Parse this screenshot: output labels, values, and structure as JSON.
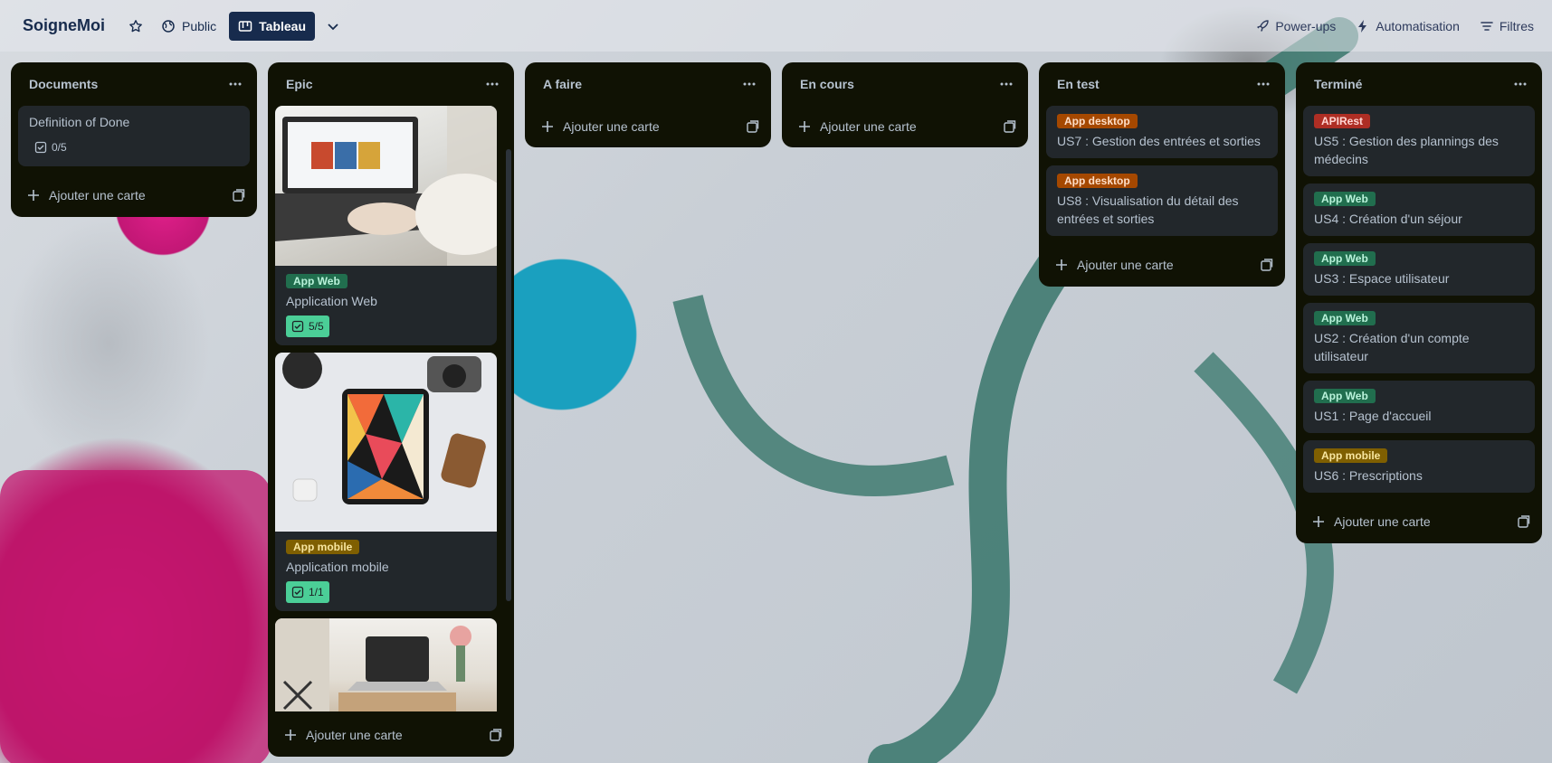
{
  "header": {
    "board_title": "SoigneMoi",
    "visibility_label": "Public",
    "view_label": "Tableau",
    "powerups_label": "Power-ups",
    "automation_label": "Automatisation",
    "filters_label": "Filtres"
  },
  "add_card_label": "Ajouter une carte",
  "lists": [
    {
      "title": "Documents",
      "cards": [
        {
          "title": "Definition of Done",
          "checklist": "0/5"
        }
      ]
    },
    {
      "title": "Epic",
      "cards": [
        {
          "label": "App Web",
          "title": "Application Web",
          "checklist": "5/5"
        },
        {
          "label": "App mobile",
          "title": "Application mobile",
          "checklist": "1/1"
        }
      ]
    },
    {
      "title": "A faire",
      "cards": []
    },
    {
      "title": "En cours",
      "cards": []
    },
    {
      "title": "En test",
      "cards": [
        {
          "label": "App desktop",
          "title": "US7 : Gestion des entrées et sorties"
        },
        {
          "label": "App desktop",
          "title": "US8 : Visualisation du détail des entrées et sorties"
        }
      ]
    },
    {
      "title": "Terminé",
      "cards": [
        {
          "label": "APIRest",
          "title": "US5 : Gestion des plannings des médecins"
        },
        {
          "label": "App Web",
          "title": "US4 : Création d'un séjour"
        },
        {
          "label": "App Web",
          "title": "US3 : Espace utilisateur"
        },
        {
          "label": "App Web",
          "title": "US2 : Création d'un compte utilisateur"
        },
        {
          "label": "App Web",
          "title": "US1 : Page d'accueil"
        },
        {
          "label": "App mobile",
          "title": "US6 : Prescriptions"
        }
      ]
    }
  ],
  "colors": {
    "list_bg": "#101204",
    "card_bg": "#22272b",
    "label_web": "#216e4e",
    "label_mobile": "#7f5f01",
    "label_desktop": "#a54800",
    "label_api": "#ae2e24",
    "checklist_done": "#4bce97"
  }
}
